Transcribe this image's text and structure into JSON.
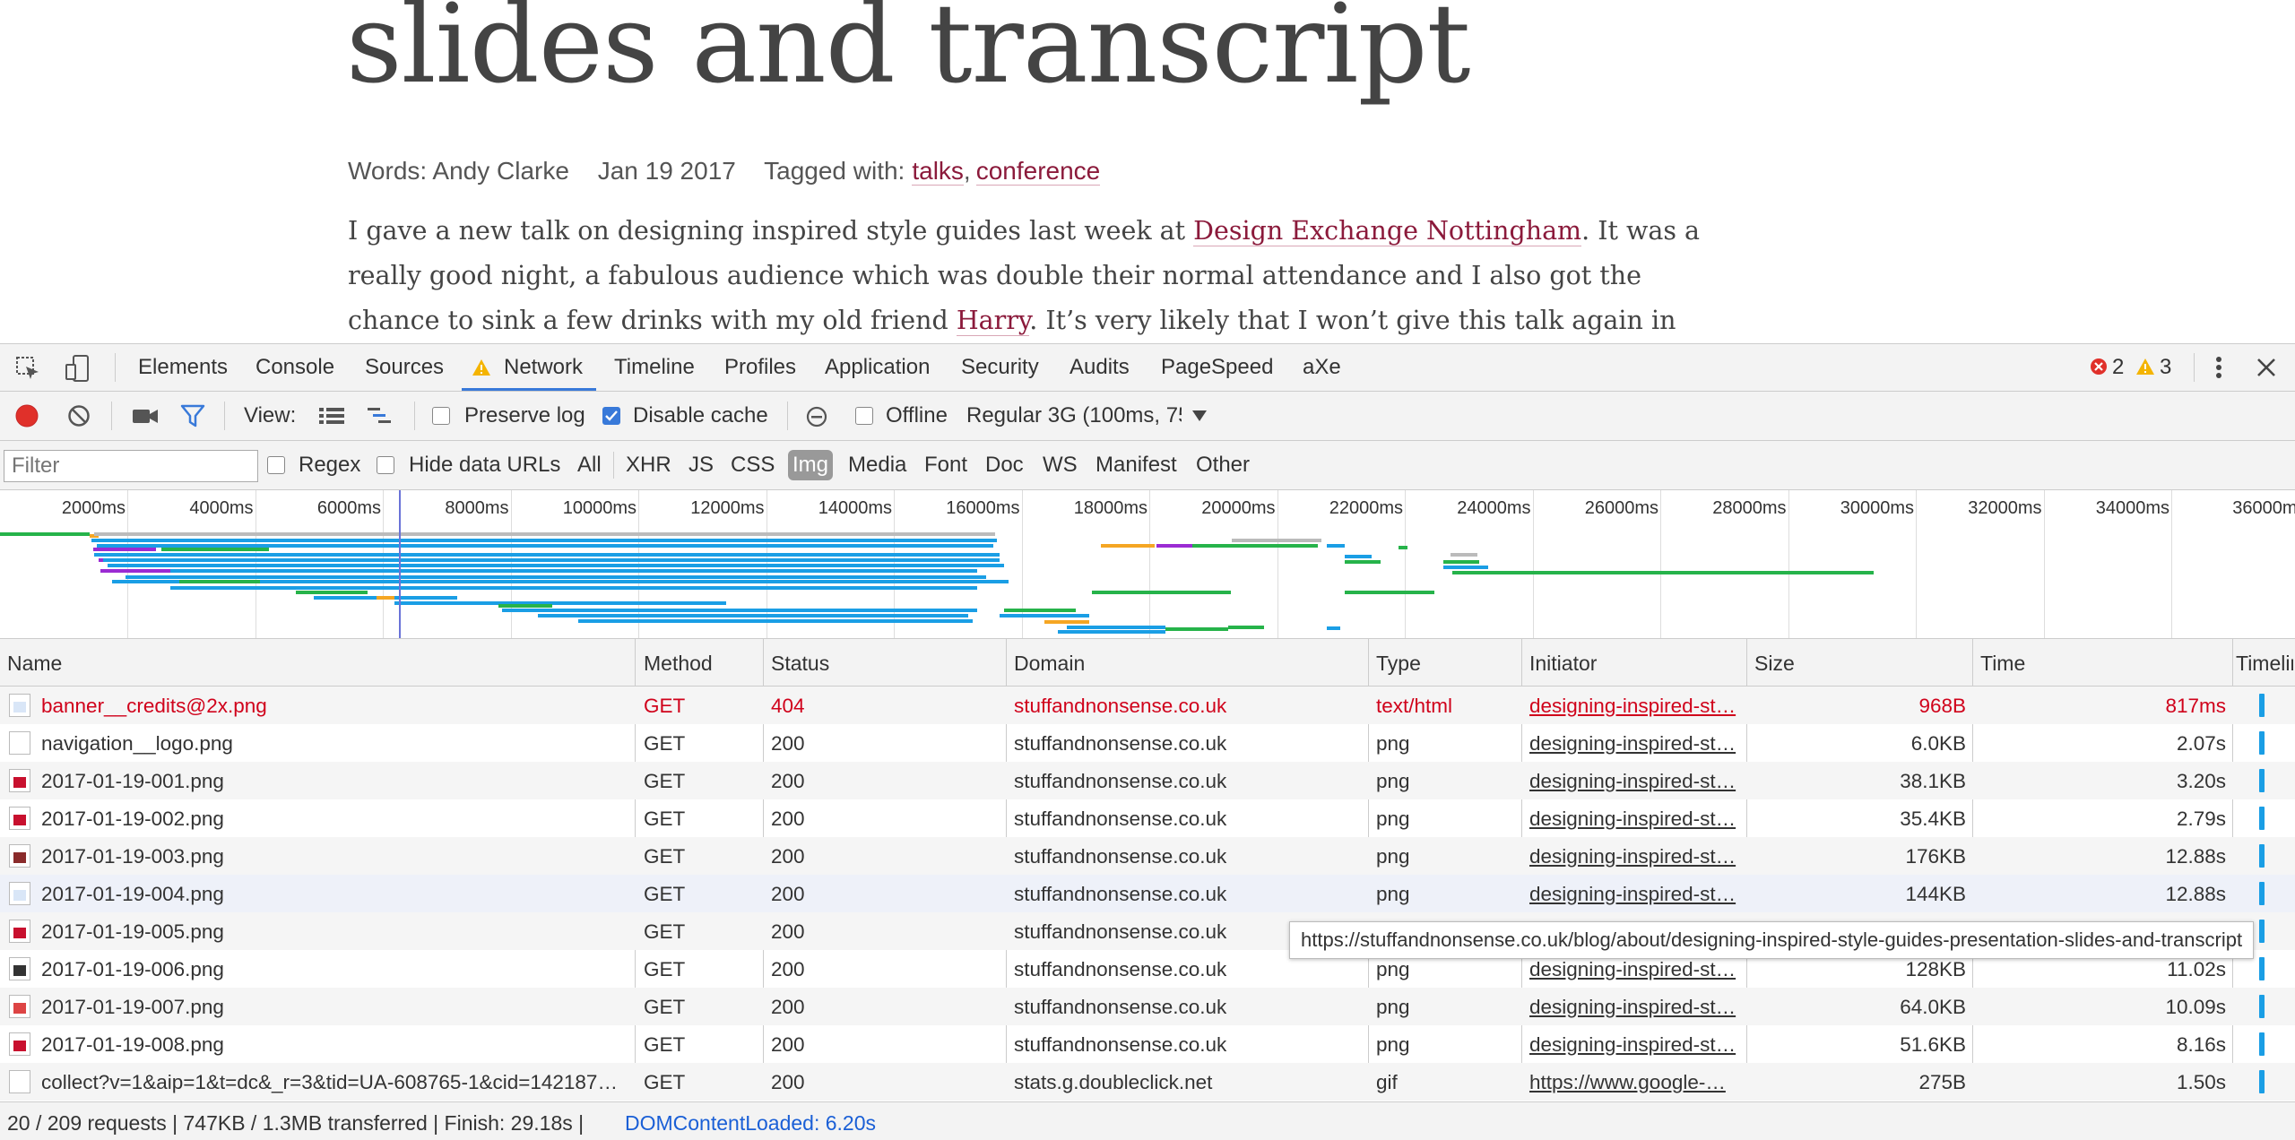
{
  "article": {
    "title": "slides and transcript",
    "author": "Words: Andy Clarke",
    "date": "Jan 19 2017",
    "tagged_label": "Tagged with:",
    "tags": [
      "talks",
      "conference"
    ],
    "intro_1": "I gave a new talk on designing inspired style guides last week at ",
    "intro_link1": "Design Exchange Nottingham",
    "intro_2": ". It was a really good night, a fabulous audience which was double their normal attendance and I also got the chance to sink a few drinks with my old friend ",
    "intro_link2": "Harry",
    "intro_3": ". It’s very likely that I won’t give this talk again in Europe this year, and I"
  },
  "devtools": {
    "tabs": [
      "Elements",
      "Console",
      "Sources",
      "Network",
      "Timeline",
      "Profiles",
      "Application",
      "Security",
      "Audits",
      "PageSpeed",
      "aXe"
    ],
    "active_tab": "Network",
    "errors": "2",
    "warnings": "3",
    "toolbar": {
      "view_label": "View:",
      "preserve_log": "Preserve log",
      "disable_cache": "Disable cache",
      "offline": "Offline",
      "throttle": "Regular 3G (100ms, 75"
    },
    "filter": {
      "placeholder": "Filter",
      "regex": "Regex",
      "hide_data_urls": "Hide data URLs",
      "types": [
        "All",
        "XHR",
        "JS",
        "CSS",
        "Img",
        "Media",
        "Font",
        "Doc",
        "WS",
        "Manifest",
        "Other"
      ],
      "active_type": "Img"
    },
    "overview_ticks": [
      "2000ms",
      "4000ms",
      "6000ms",
      "8000ms",
      "10000ms",
      "12000ms",
      "14000ms",
      "16000ms",
      "18000ms",
      "20000ms",
      "22000ms",
      "24000ms",
      "26000ms",
      "28000ms",
      "30000ms",
      "32000ms",
      "34000ms",
      "36000m"
    ],
    "columns": [
      "Name",
      "Method",
      "Status",
      "Domain",
      "Type",
      "Initiator",
      "Size",
      "Time",
      "Timelin"
    ],
    "requests": [
      {
        "name": "banner__credits@2x.png",
        "method": "GET",
        "status": "404",
        "domain": "stuffandnonsense.co.uk",
        "type": "text/html",
        "initiator": "designing-inspired-st…",
        "size": "968B",
        "time": "817ms"
      },
      {
        "name": "navigation__logo.png",
        "method": "GET",
        "status": "200",
        "domain": "stuffandnonsense.co.uk",
        "type": "png",
        "initiator": "designing-inspired-st…",
        "size": "6.0KB",
        "time": "2.07s"
      },
      {
        "name": "2017-01-19-001.png",
        "method": "GET",
        "status": "200",
        "domain": "stuffandnonsense.co.uk",
        "type": "png",
        "initiator": "designing-inspired-st…",
        "size": "38.1KB",
        "time": "3.20s"
      },
      {
        "name": "2017-01-19-002.png",
        "method": "GET",
        "status": "200",
        "domain": "stuffandnonsense.co.uk",
        "type": "png",
        "initiator": "designing-inspired-st…",
        "size": "35.4KB",
        "time": "2.79s"
      },
      {
        "name": "2017-01-19-003.png",
        "method": "GET",
        "status": "200",
        "domain": "stuffandnonsense.co.uk",
        "type": "png",
        "initiator": "designing-inspired-st…",
        "size": "176KB",
        "time": "12.88s"
      },
      {
        "name": "2017-01-19-004.png",
        "method": "GET",
        "status": "200",
        "domain": "stuffandnonsense.co.uk",
        "type": "png",
        "initiator": "designing-inspired-st…",
        "size": "144KB",
        "time": "12.88s"
      },
      {
        "name": "2017-01-19-005.png",
        "method": "GET",
        "status": "200",
        "domain": "stuffandnonsense.co.uk",
        "type": "",
        "initiator": "",
        "size": "",
        "time": ""
      },
      {
        "name": "2017-01-19-006.png",
        "method": "GET",
        "status": "200",
        "domain": "stuffandnonsense.co.uk",
        "type": "png",
        "initiator": "designing-inspired-st…",
        "size": "128KB",
        "time": "11.02s"
      },
      {
        "name": "2017-01-19-007.png",
        "method": "GET",
        "status": "200",
        "domain": "stuffandnonsense.co.uk",
        "type": "png",
        "initiator": "designing-inspired-st…",
        "size": "64.0KB",
        "time": "10.09s"
      },
      {
        "name": "2017-01-19-008.png",
        "method": "GET",
        "status": "200",
        "domain": "stuffandnonsense.co.uk",
        "type": "png",
        "initiator": "designing-inspired-st…",
        "size": "51.6KB",
        "time": "8.16s"
      },
      {
        "name": "collect?v=1&aip=1&t=dc&_r=3&tid=UA-608765-1&cid=1421878…",
        "method": "GET",
        "status": "200",
        "domain": "stats.g.doubleclick.net",
        "type": "gif",
        "initiator": "https://www.google-…",
        "size": "275B",
        "time": "1.50s"
      }
    ],
    "tooltip": "https://stuffandnonsense.co.uk/blog/about/designing-inspired-style-guides-presentation-slides-and-transcript",
    "status": {
      "summary": "20 / 209 requests | 747KB / 1.3MB transferred | Finish: 29.18s | ",
      "dom_content_loaded": "DOMContentLoaded: 6.20s"
    },
    "colors": {
      "accent": "#3879d9",
      "error": "#d0021b",
      "link": "#8b1a3b",
      "bar_blue": "#1a9ee5",
      "bar_green": "#26b34a"
    }
  }
}
